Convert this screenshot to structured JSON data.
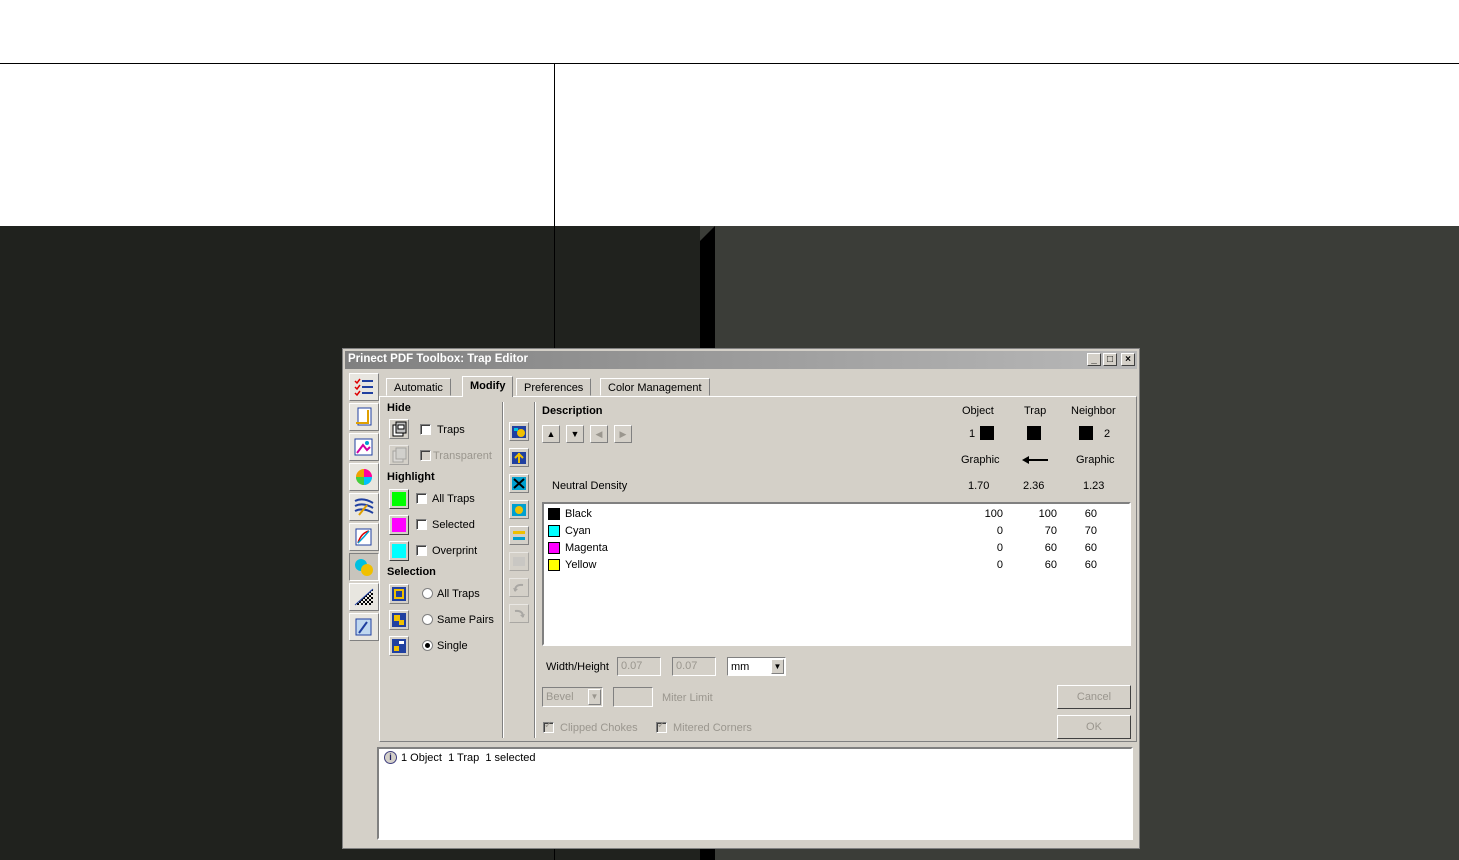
{
  "dialog": {
    "title": "Prinect PDF Toolbox: Trap Editor",
    "window_buttons": {
      "minimize": "_",
      "maximize": "□",
      "close": "×"
    }
  },
  "tabs": [
    {
      "label": "Automatic",
      "active": false
    },
    {
      "label": "Modify",
      "active": true
    },
    {
      "label": "Preferences",
      "active": false
    },
    {
      "label": "Color Management",
      "active": false
    }
  ],
  "hide": {
    "heading": "Hide",
    "traps_label": "Traps",
    "transparent_label": "Transparent"
  },
  "highlight": {
    "heading": "Highlight",
    "items": [
      {
        "label": "All Traps",
        "color": "#00ff00"
      },
      {
        "label": "Selected",
        "color": "#ff00ff"
      },
      {
        "label": "Overprint",
        "color": "#00ffff"
      }
    ]
  },
  "selection": {
    "heading": "Selection",
    "options": [
      {
        "label": "All Traps",
        "selected": false
      },
      {
        "label": "Same Pairs",
        "selected": false
      },
      {
        "label": "Single",
        "selected": true
      }
    ]
  },
  "description": {
    "heading": "Description",
    "col_object": "Object",
    "col_trap": "Trap",
    "col_neighbor": "Neighbor",
    "object_number": "1",
    "neighbor_number": "2",
    "object_type": "Graphic",
    "neighbor_type": "Graphic",
    "neutral_density_label": "Neutral Density",
    "nd_object": "1.70",
    "nd_trap": "2.36",
    "nd_neighbor": "1.23"
  },
  "inks": [
    {
      "name": "Black",
      "color": "#000000",
      "object": "100",
      "trap": "100",
      "neighbor": "60"
    },
    {
      "name": "Cyan",
      "color": "#00ffff",
      "object": "0",
      "trap": "70",
      "neighbor": "70"
    },
    {
      "name": "Magenta",
      "color": "#ff00ff",
      "object": "0",
      "trap": "60",
      "neighbor": "60"
    },
    {
      "name": "Yellow",
      "color": "#ffff00",
      "object": "0",
      "trap": "60",
      "neighbor": "60"
    }
  ],
  "settings": {
    "width_height_label": "Width/Height",
    "width_value": "0.07",
    "height_value": "0.07",
    "unit": "mm",
    "join_type": "Bevel",
    "miter_limit_label": "Miter Limit",
    "clipped_chokes_label": "Clipped Chokes",
    "mitered_corners_label": "Mitered Corners"
  },
  "buttons": {
    "cancel": "Cancel",
    "ok": "OK"
  },
  "status": {
    "text": "1 Object  1 Trap  1 selected",
    "icon": "info-icon"
  }
}
